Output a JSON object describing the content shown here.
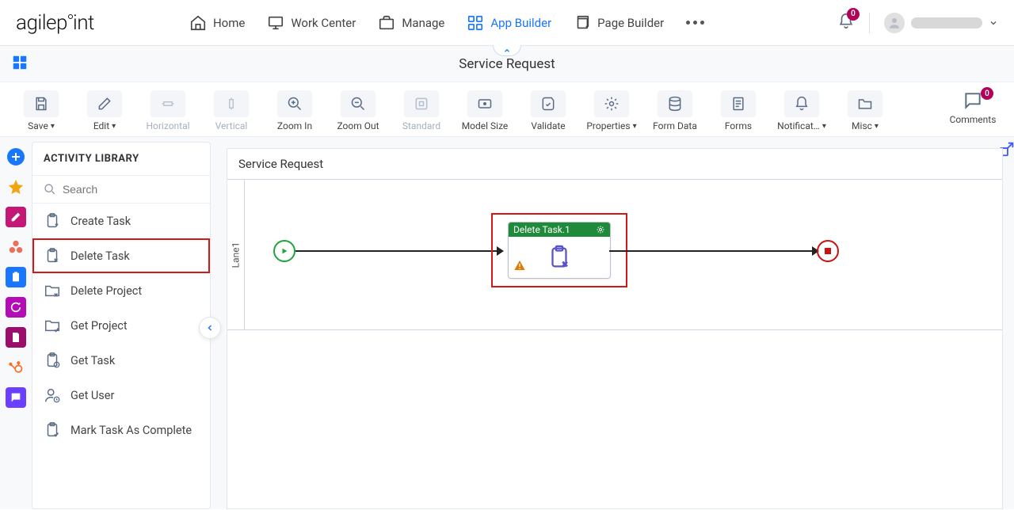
{
  "nav": {
    "home": "Home",
    "work_center": "Work Center",
    "manage": "Manage",
    "app_builder": "App Builder",
    "page_builder": "Page Builder",
    "notif_count": "0"
  },
  "subheader": {
    "title": "Service Request"
  },
  "toolbar": {
    "save": "Save",
    "edit": "Edit",
    "horizontal": "Horizontal",
    "vertical": "Vertical",
    "zoom_in": "Zoom In",
    "zoom_out": "Zoom Out",
    "standard": "Standard",
    "model_size": "Model Size",
    "validate": "Validate",
    "properties": "Properties",
    "form_data": "Form Data",
    "forms": "Forms",
    "notifications": "Notificat…",
    "misc": "Misc",
    "comments": "Comments",
    "comments_count": "0"
  },
  "library": {
    "title": "ACTIVITY LIBRARY",
    "search_placeholder": "Search",
    "items": [
      {
        "label": "Create Task"
      },
      {
        "label": "Delete Task"
      },
      {
        "label": "Delete Project"
      },
      {
        "label": "Get Project"
      },
      {
        "label": "Get Task"
      },
      {
        "label": "Get User"
      },
      {
        "label": "Mark Task As Complete"
      }
    ]
  },
  "canvas": {
    "title": "Service Request",
    "lane": "Lane1",
    "task_node_title": "Delete Task.1"
  }
}
